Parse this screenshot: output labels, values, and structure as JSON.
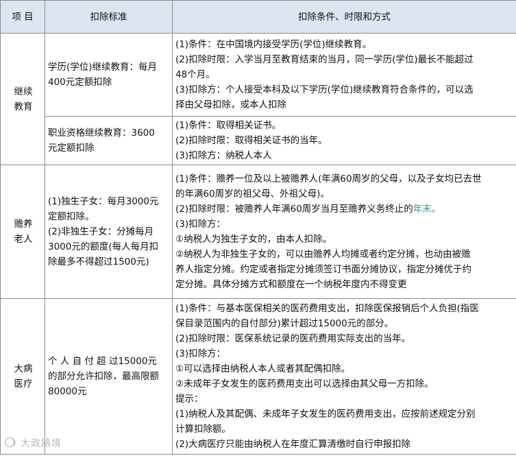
{
  "header": {
    "col1": "项 目",
    "col2": "扣除标准",
    "col3": "扣除条件、时限和方式"
  },
  "rows": [
    {
      "category": [
        "继续",
        "教育"
      ],
      "subrows": [
        {
          "standard": [
            "学历(学位)继续教育：每月",
            "400元定额扣除"
          ],
          "conditions": [
            "(1)条件：在中国境内接受学历(学位)继续教育。",
            "(2)扣除时限：入学当月至教育结束的当月，同一学历(学位)最长不能超过",
            "48个月。",
            "(3)扣除方：个人接受本科及以下学历(学位)继续教育符合条件的，可以选",
            "择由父母扣除，或本人扣除"
          ]
        },
        {
          "standard": [
            "职业资格继续教育：3600",
            "元定额扣除"
          ],
          "conditions": [
            "(1)条件：取得相关证书。",
            "(2)扣除时限：取得相关证书的当年。",
            "(3)扣除方：纳税人本人"
          ]
        }
      ]
    },
    {
      "category": [
        "赡养",
        "老人"
      ],
      "standard": [
        "(1)独生子女：每月3000元",
        "定额扣除。",
        "(2)非独生子女：分摊每月",
        "3000元的额度(每人每月扣",
        "除最多不得超过1500元)"
      ],
      "conditions": [
        "(1)条件：赡养一位及以上被赡养人(年满60周岁的父母，以及子女均已去世",
        "的年满60周岁的祖父母、外祖父母)。",
        "(2)扣除时限：被赡养人年满60周岁当月至赡养义务终止的",
        "(3)扣除方：",
        "①纳税人为独生子女的，由本人扣除。",
        "②纳税人为非独生子女的，可以由赡养人均摊或者约定分摊，也动由被赡",
        "养人指定分摊。约定或者指定分摊须签订书面分摊协议，指定分摊优于约",
        "定分摊。具体分摊方式和额度在一个纳税年度内不得变更"
      ],
      "highlight": "年末。"
    },
    {
      "category": [
        "大病",
        "医疗"
      ],
      "standard": [
        "个 人 自 付 超 过15000元",
        "的部分允许扣除，最高限额",
        "80000元"
      ],
      "conditions": [
        "(1)条件：与基本医保相关的医药费用支出，扣除医保报销后个人负担(指医",
        "保目录范围内的自付部分)累计超过15000元的部分。",
        "(2)扣除时限：医保系统记录的医药费用实际支出的当年。",
        "(3)扣除方：",
        "①可以选择由纳税人本人或者其配偶扣除。",
        "②未成年子女发生的医药费用支出可以选择由其父母一方扣除。",
        "提示：",
        "(1)纳税人及其配偶、未成年子女发生的医药费用支出，应按前述规定分别",
        "计算扣除额。",
        "(2)大病医疗只能由纳税人在年度汇算清缴时自行申报扣除"
      ]
    }
  ],
  "watermark": "大政路境",
  "colors": {
    "header_bg": "#dce6f1",
    "border": "#8a8a8a",
    "highlight": "#3a9a8e"
  }
}
